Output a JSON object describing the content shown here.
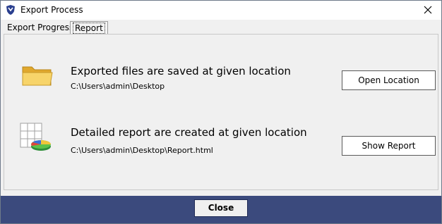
{
  "window": {
    "title": "Export Process",
    "close_glyph": "×"
  },
  "tabs": [
    {
      "label": "Export Progress",
      "active": false
    },
    {
      "label": "Report",
      "active": true
    }
  ],
  "sections": {
    "exported": {
      "icon": "folder-icon",
      "heading": "Exported files are saved at given location",
      "path": "C:\\Users\\admin\\Desktop",
      "button_label": "Open Location"
    },
    "report": {
      "icon": "report-chart-icon",
      "heading": "Detailed report are created at given location",
      "path": "C:\\Users\\admin\\Desktop\\Report.html",
      "button_label": "Show Report"
    }
  },
  "footer": {
    "close_label": "Close"
  },
  "colors": {
    "footer_bg": "#3b4a7d",
    "accent": "#1f3a8a",
    "folder": "#f3c650"
  }
}
